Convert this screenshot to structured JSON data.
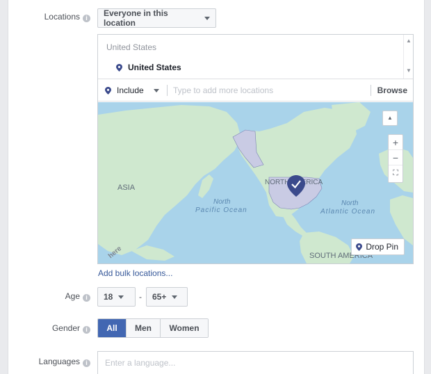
{
  "locations": {
    "label": "Locations",
    "info": "i",
    "dropdown_value": "Everyone in this location",
    "list_header": "United States",
    "selected_item": "United States",
    "include_value": "Include",
    "search_placeholder": "Type to add more locations",
    "browse_label": "Browse",
    "map": {
      "labels": [
        "ASIA",
        "North",
        "Pacific Ocean",
        "NORTH AMERICA",
        "North",
        "Atlantic Ocean",
        "SOUTH AMERICA",
        "here"
      ],
      "zoom_in": "+",
      "zoom_out": "−",
      "drop_pin_label": "Drop Pin",
      "land_color": "#cfe8cf",
      "water_color": "#a9d3ea",
      "highlight_color": "#c9cbe4"
    },
    "bulk_link": "Add bulk locations..."
  },
  "age": {
    "label": "Age",
    "info": "i",
    "min": "18",
    "separator": "-",
    "max": "65+"
  },
  "gender": {
    "label": "Gender",
    "info": "i",
    "options": [
      "All",
      "Men",
      "Women"
    ],
    "selected": "All"
  },
  "languages": {
    "label": "Languages",
    "info": "i",
    "placeholder": "Enter a language..."
  },
  "colors": {
    "accent": "#4267b2",
    "link": "#365899",
    "pin": "#3b4a8c"
  }
}
